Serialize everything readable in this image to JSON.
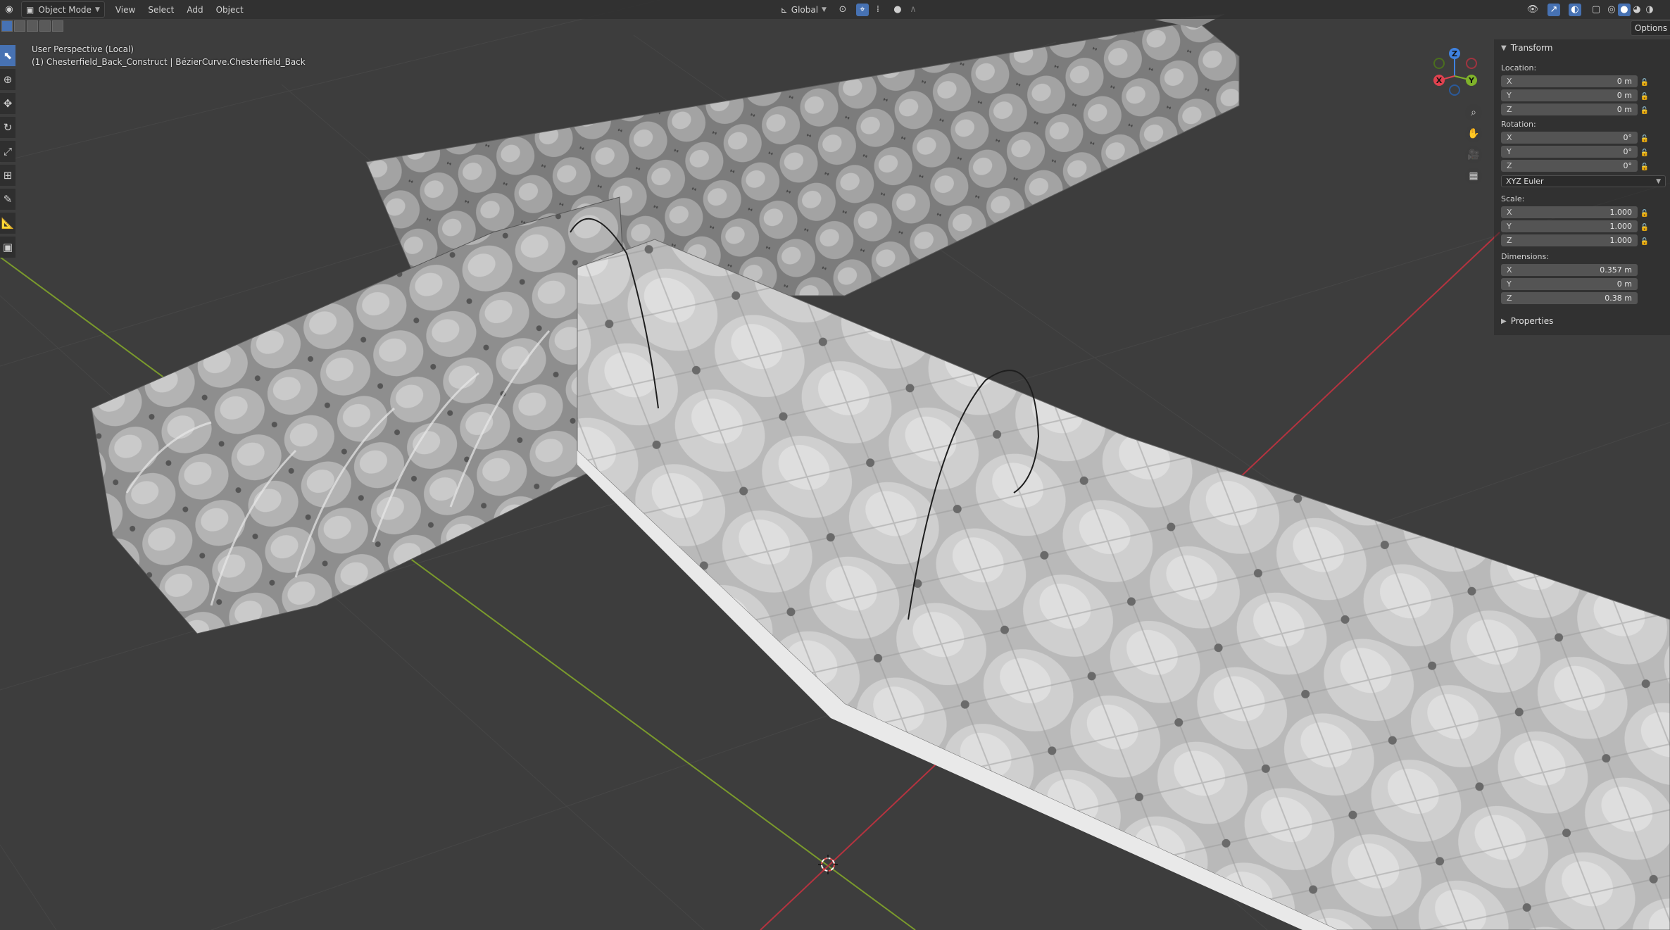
{
  "header": {
    "mode_label": "Object Mode",
    "menus": [
      "View",
      "Select",
      "Add",
      "Object"
    ],
    "orientation_label": "Global"
  },
  "viewport": {
    "perspective_label": "User Perspective (Local)",
    "object_label": "(1) Chesterfield_Back_Construct | BézierCurve.Chesterfield_Back"
  },
  "gizmo": {
    "z": "Z",
    "y": "Y",
    "x": "X"
  },
  "options_label": "Options",
  "sidebar": {
    "transform_title": "Transform",
    "location_label": "Location:",
    "location": [
      {
        "axis": "X",
        "value": "0 m"
      },
      {
        "axis": "Y",
        "value": "0 m"
      },
      {
        "axis": "Z",
        "value": "0 m"
      }
    ],
    "rotation_label": "Rotation:",
    "rotation": [
      {
        "axis": "X",
        "value": "0°"
      },
      {
        "axis": "Y",
        "value": "0°"
      },
      {
        "axis": "Z",
        "value": "0°"
      }
    ],
    "rotation_mode": "XYZ Euler",
    "scale_label": "Scale:",
    "scale": [
      {
        "axis": "X",
        "value": "1.000"
      },
      {
        "axis": "Y",
        "value": "1.000"
      },
      {
        "axis": "Z",
        "value": "1.000"
      }
    ],
    "dimensions_label": "Dimensions:",
    "dimensions": [
      {
        "axis": "X",
        "value": "0.357 m"
      },
      {
        "axis": "Y",
        "value": "0 m"
      },
      {
        "axis": "Z",
        "value": "0.38 m"
      }
    ],
    "properties_title": "Properties"
  },
  "colors": {
    "background": "#3d3d3d",
    "accent": "#4772b3",
    "axis_x": "#e0424f",
    "axis_y": "#7fb22a",
    "axis_z": "#3f82e0"
  }
}
